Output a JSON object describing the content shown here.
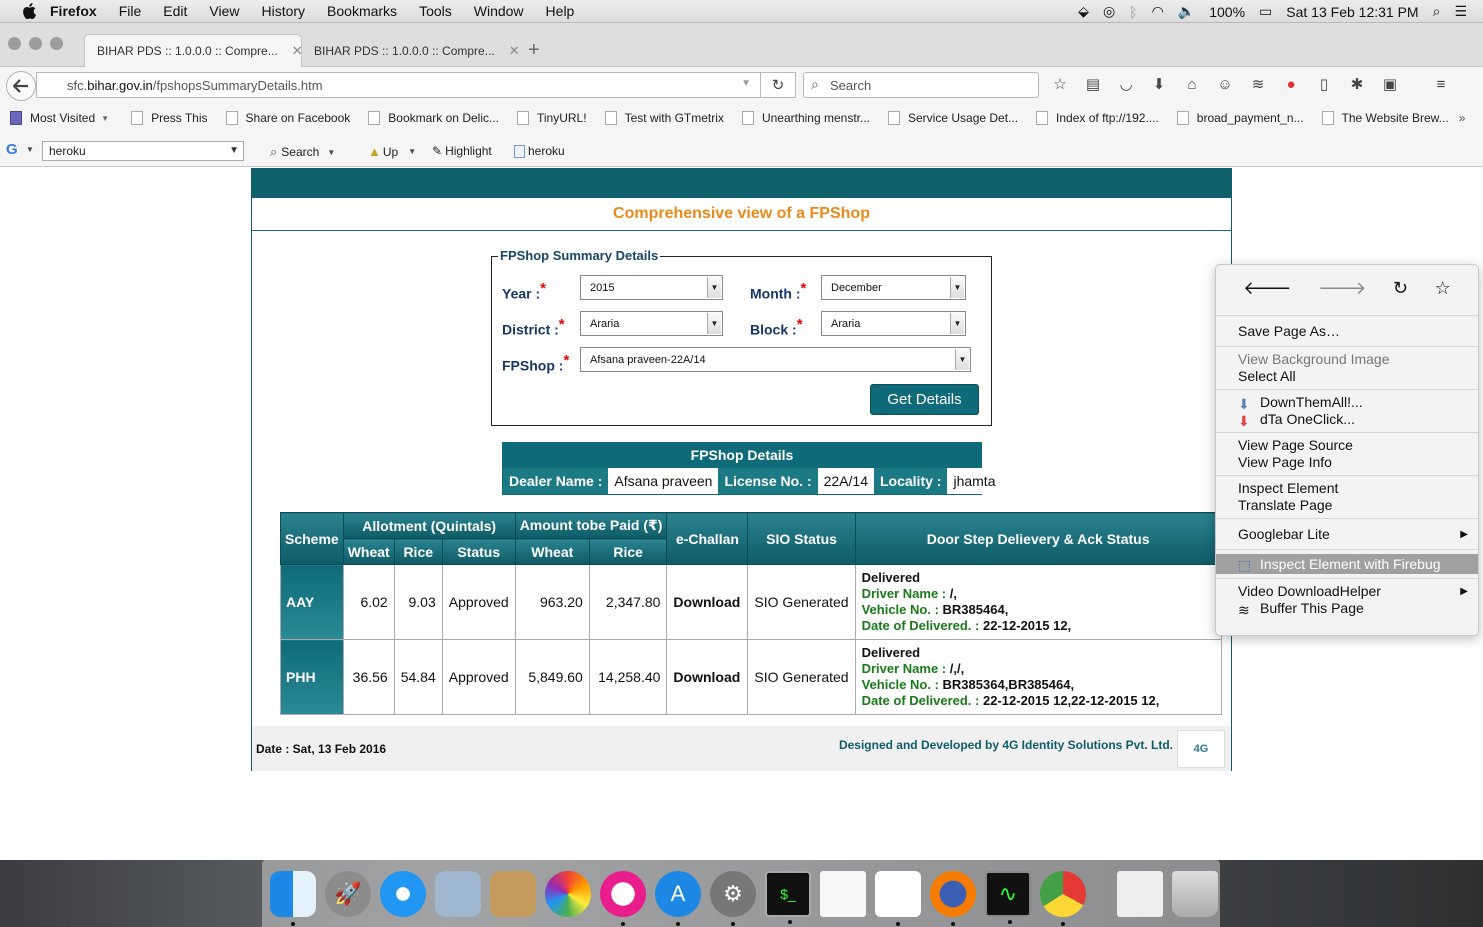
{
  "menubar": {
    "app": "Firefox",
    "items": [
      "File",
      "Edit",
      "View",
      "History",
      "Bookmarks",
      "Tools",
      "Window",
      "Help"
    ],
    "battery": "100%",
    "clock": "Sat 13 Feb  12:31 PM"
  },
  "tabs": [
    {
      "title": "BIHAR PDS :: 1.0.0.0 :: Compre...",
      "active": true
    },
    {
      "title": "BIHAR PDS :: 1.0.0.0 :: Compre...",
      "active": false
    }
  ],
  "nav": {
    "url_prefix": "sfc.",
    "url_host": "bihar.gov.in",
    "url_path": "/fpshopsSummaryDetails.htm",
    "search_placeholder": "Search"
  },
  "bookmarks": [
    "Most Visited",
    "Press This",
    "Share on Facebook",
    "Bookmark on Delic...",
    "TinyURL!",
    "Test with GTmetrix",
    "Unearthing menstr...",
    "Service Usage Det...",
    "Index of ftp://192....",
    "broad_payment_n...",
    "The Website Brew..."
  ],
  "googlebar": {
    "query": "heroku",
    "search": "Search",
    "up": "Up",
    "highlight": "Highlight",
    "term": "heroku"
  },
  "page": {
    "title": "Comprehensive view of a FPShop",
    "form": {
      "legend": "FPShop Summary Details",
      "year_label": "Year :",
      "year_value": "2015",
      "month_label": "Month :",
      "month_value": "December",
      "district_label": "District :",
      "district_value": "Araria",
      "block_label": "Block :",
      "block_value": "Araria",
      "fpshop_label": "FPShop :",
      "fpshop_value": "Afsana praveen-22A/14",
      "required_mark": "*",
      "submit": "Get Details"
    },
    "details": {
      "header": "FPShop Details",
      "dealer_label": "Dealer Name :",
      "dealer_value": "Afsana praveen",
      "license_label": "License No. :",
      "license_value": "22A/14",
      "locality_label": "Locality :",
      "locality_value": "jhamta"
    },
    "table": {
      "h_scheme": "Scheme",
      "h_allotment": "Allotment (Quintals)",
      "h_amount": "Amount tobe Paid (₹)",
      "h_echallan": "e-Challan",
      "h_sio": "SIO Status",
      "h_door": "Door Step Delievery & Ack Status",
      "h_wheat": "Wheat",
      "h_rice": "Rice",
      "h_status": "Status",
      "h_wheat2": "Wheat",
      "h_rice2": "Rice",
      "rows": [
        {
          "scheme": "AAY",
          "wheat": "6.02",
          "rice": "9.03",
          "status": "Approved",
          "amt_wheat": "963.20",
          "amt_rice": "2,347.80",
          "echallan": "Download",
          "sio": "SIO Generated",
          "door_status": "Delivered",
          "driver_label": "Driver Name :",
          "driver": "/,",
          "vehicle_label": "Vehicle No. :",
          "vehicle": "BR385464,",
          "date_label": "Date of Delivered. :",
          "date": "22-12-2015 12,"
        },
        {
          "scheme": "PHH",
          "wheat": "36.56",
          "rice": "54.84",
          "status": "Approved",
          "amt_wheat": "5,849.60",
          "amt_rice": "14,258.40",
          "echallan": "Download",
          "sio": "SIO Generated",
          "door_status": "Delivered",
          "driver_label": "Driver Name :",
          "driver": "/,/,",
          "vehicle_label": "Vehicle No. :",
          "vehicle": "BR385364,BR385464,",
          "date_label": "Date of Delivered. :",
          "date": "22-12-2015 12,22-12-2015 12,"
        }
      ]
    },
    "footer": {
      "date": "Date : Sat, 13 Feb 2016",
      "developer": "Designed and Developed by 4G Identity Solutions Pvt. Ltd.",
      "logo": "4G"
    }
  },
  "context_menu": {
    "save_page_as": "Save Page As…",
    "view_bg": "View Background Image",
    "select_all": "Select All",
    "downthemall": "DownThemAll!...",
    "dta_oneclick": "dTa OneClick...",
    "view_source": "View Page Source",
    "view_info": "View Page Info",
    "inspect": "Inspect Element",
    "translate": "Translate Page",
    "googlebar": "Googlebar Lite",
    "firebug": "Inspect Element with Firebug",
    "video_dl": "Video DownloadHelper",
    "buffer": "Buffer This Page"
  },
  "dock": [
    "finder",
    "launchpad",
    "safari",
    "preview",
    "contacts",
    "photos",
    "itunes",
    "app-store",
    "system-preferences",
    "terminal",
    "textedit",
    "numbers",
    "firefox",
    "activity-monitor",
    "chrome",
    "documents",
    "trash"
  ]
}
